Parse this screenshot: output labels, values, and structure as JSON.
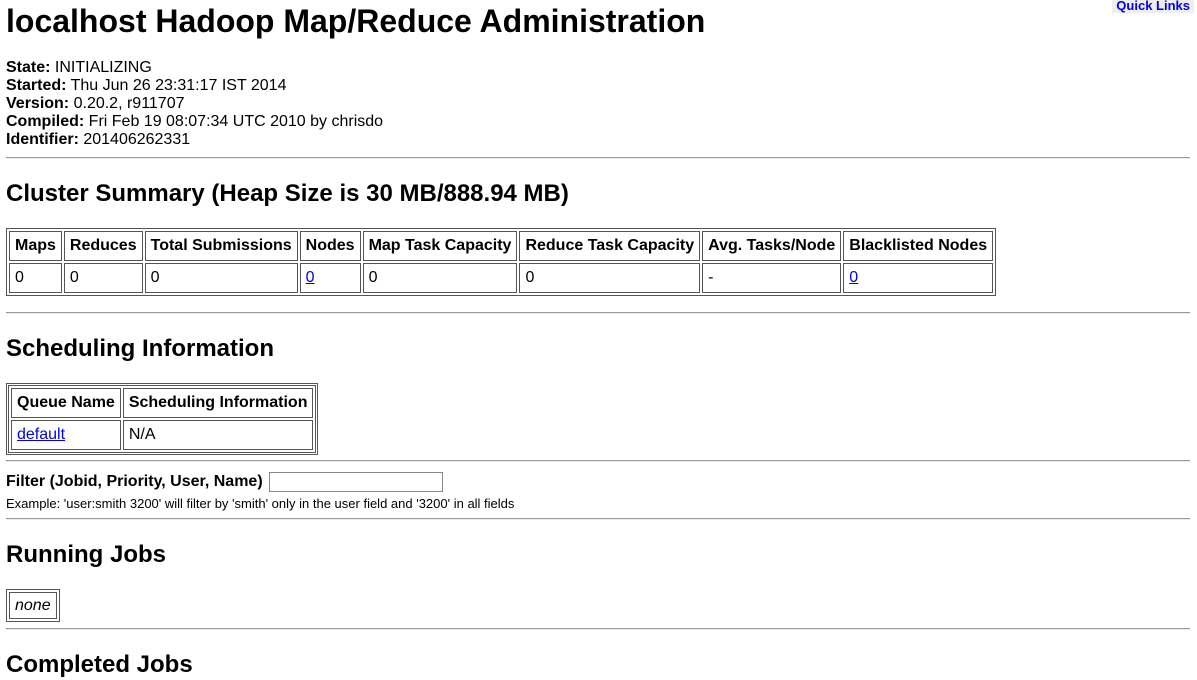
{
  "quick_links": "Quick Links",
  "title": "localhost Hadoop Map/Reduce Administration",
  "info": [
    {
      "label": "State:",
      "value": "INITIALIZING"
    },
    {
      "label": "Started:",
      "value": "Thu Jun 26 23:31:17 IST 2014"
    },
    {
      "label": "Version:",
      "value": "0.20.2, r911707"
    },
    {
      "label": "Compiled:",
      "value": "Fri Feb 19 08:07:34 UTC 2010 by chrisdo"
    },
    {
      "label": "Identifier:",
      "value": "201406262331"
    }
  ],
  "cluster": {
    "heading": "Cluster Summary (Heap Size is 30 MB/888.94 MB)",
    "headers": [
      "Maps",
      "Reduces",
      "Total Submissions",
      "Nodes",
      "Map Task Capacity",
      "Reduce Task Capacity",
      "Avg. Tasks/Node",
      "Blacklisted Nodes"
    ],
    "values": [
      "0",
      "0",
      "0",
      "0",
      "0",
      "0",
      "-",
      "0"
    ]
  },
  "scheduling": {
    "heading": "Scheduling Information",
    "headers": [
      "Queue Name",
      "Scheduling Information"
    ],
    "rows": [
      [
        "default",
        "N/A"
      ]
    ]
  },
  "filter": {
    "label": "Filter (Jobid, Priority, User, Name)",
    "value": "",
    "example": "Example: 'user:smith 3200' will filter by 'smith' only in the user field and '3200' in all fields"
  },
  "running": {
    "heading": "Running Jobs",
    "empty": "none"
  },
  "completed": {
    "heading": "Completed Jobs"
  }
}
